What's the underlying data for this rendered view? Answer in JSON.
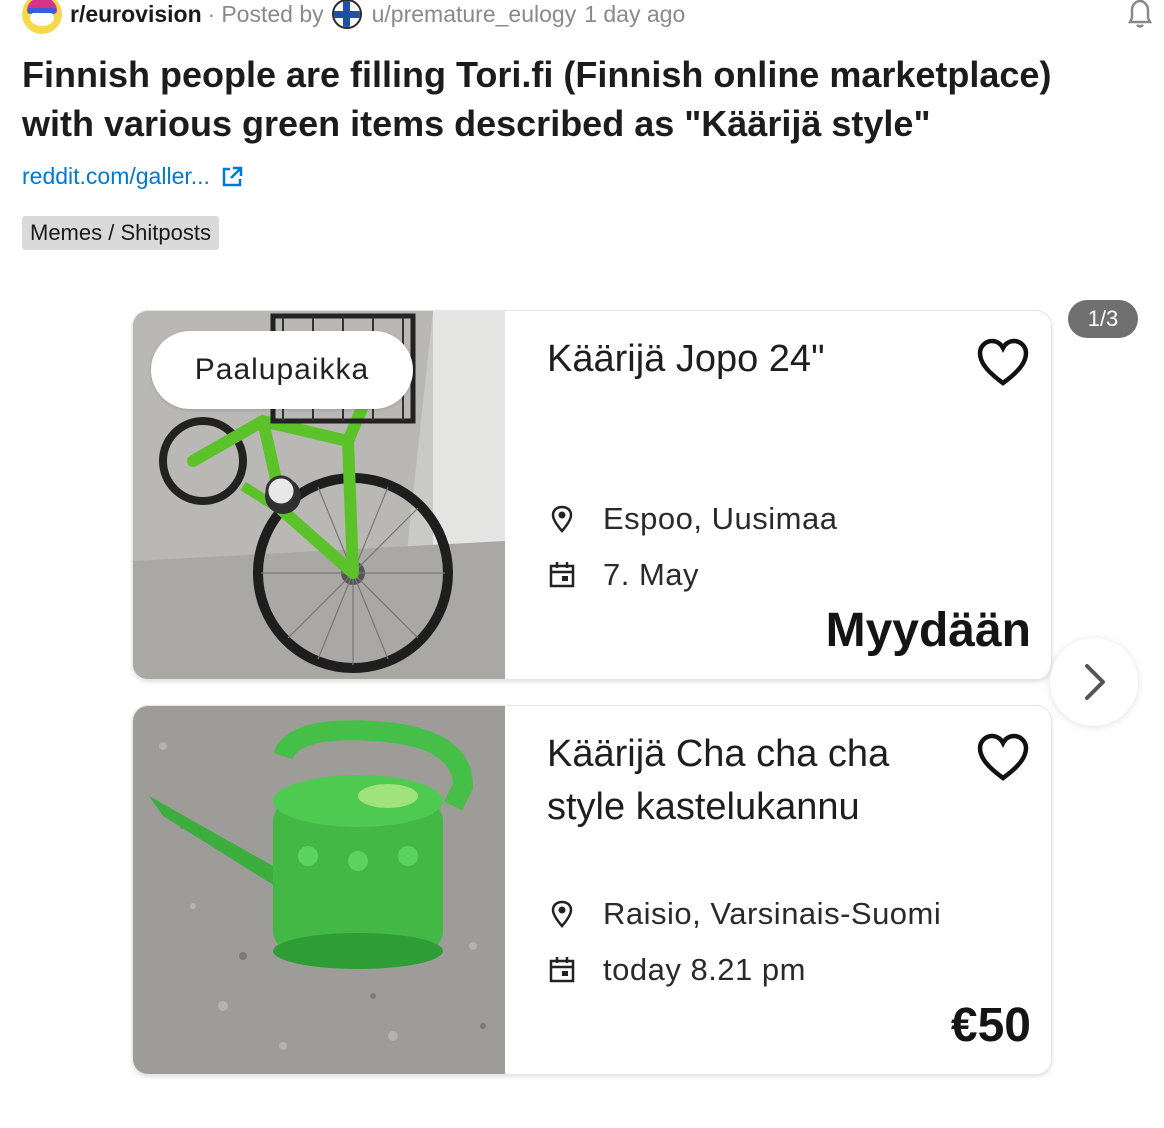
{
  "post": {
    "subreddit": "r/eurovision",
    "separator": "·",
    "posted_by_label": "Posted by",
    "username": "u/premature_eulogy",
    "time_ago": "1 day ago",
    "title": "Finnish people are filling Tori.fi (Finnish online marketplace) with various green items described as \"Käärijä style\"",
    "link_text": "reddit.com/galler...",
    "flair": "Memes / Shitposts"
  },
  "gallery": {
    "counter": "1/3",
    "listings": [
      {
        "badge": "Paalupaikka",
        "title": "Käärijä Jopo 24\"",
        "location": "Espoo, Uusimaa",
        "date": "7. May",
        "price": "Myydään"
      },
      {
        "title": "Käärijä Cha cha cha style kastelukannu",
        "location": "Raisio, Varsinais-Suomi",
        "date": "today 8.21 pm",
        "price": "€50"
      }
    ]
  },
  "colors": {
    "link": "#0079d3",
    "flair_bg": "#dadada",
    "counter_bg": "#6f6f6f",
    "item_green": "#3fbf4a"
  },
  "icons": [
    "subreddit-avatar-icon",
    "finland-flag-icon",
    "bell-icon",
    "external-link-icon",
    "heart-icon",
    "location-pin-icon",
    "calendar-icon",
    "chevron-right-icon"
  ]
}
